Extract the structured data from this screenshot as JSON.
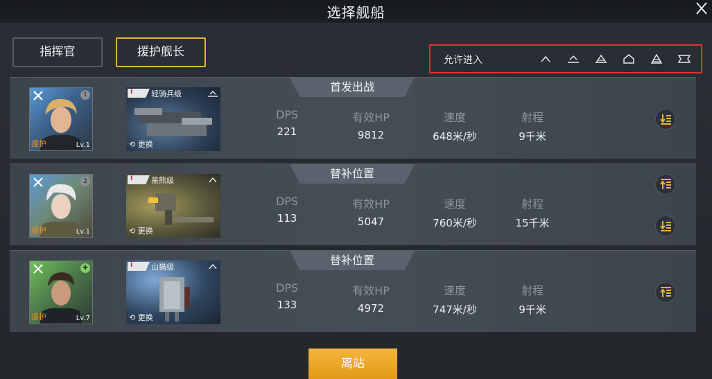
{
  "header": {
    "title": "选择舰船"
  },
  "tabs": [
    {
      "label": "指挥官"
    },
    {
      "label": "援护舰长"
    }
  ],
  "filter": {
    "label": "允许进入",
    "icons": [
      "chevron-up-icon",
      "tier-1-icon",
      "tier-2-icon",
      "tier-3-icon",
      "tier-4-icon",
      "tier-5-icon"
    ]
  },
  "stat_labels": {
    "dps": "DPS",
    "hp": "有效HP",
    "speed": "速度",
    "range": "射程"
  },
  "rows": [
    {
      "position": "首发出战",
      "captain": {
        "role": "援护",
        "level": "Lv.1",
        "badge": "1"
      },
      "ship": {
        "tier": "I",
        "class": "轻骑兵级",
        "swap": "更换"
      },
      "dps": "221",
      "hp": "9812",
      "speed": "648米/秒",
      "range": "9千米"
    },
    {
      "position": "替补位置",
      "captain": {
        "role": "援护",
        "level": "Lv.1",
        "badge": "2"
      },
      "ship": {
        "tier": "I",
        "class": "黑熊级",
        "swap": "更换"
      },
      "dps": "113",
      "hp": "5047",
      "speed": "760米/秒",
      "range": "15千米"
    },
    {
      "position": "替补位置",
      "captain": {
        "role": "援护",
        "level": "Lv.7",
        "badge": "✚"
      },
      "ship": {
        "tier": "I",
        "class": "山猫级",
        "swap": "更换"
      },
      "dps": "133",
      "hp": "4972",
      "speed": "747米/秒",
      "range": "9千米"
    }
  ],
  "footer": {
    "leave_label": "离站"
  },
  "colors": {
    "accent": "#e7b13a",
    "highlight_box": "#e0322e",
    "button": "#f0a92c"
  }
}
